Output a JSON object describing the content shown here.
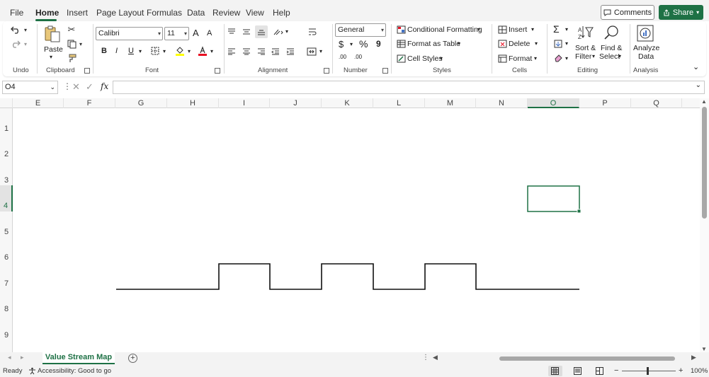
{
  "menu": {
    "tabs": [
      "File",
      "Home",
      "Insert",
      "Page Layout",
      "Formulas",
      "Data",
      "Review",
      "View",
      "Help"
    ],
    "active": "Home",
    "comments_label": "Comments",
    "share_label": "Share"
  },
  "ribbon": {
    "undo": {
      "group": "Undo"
    },
    "clipboard": {
      "group": "Clipboard",
      "paste": "Paste"
    },
    "font": {
      "group": "Font",
      "name": "Calibri",
      "size": "11",
      "bold": "B",
      "italic": "I",
      "underline": "U",
      "grow": "A",
      "shrink": "A"
    },
    "alignment": {
      "group": "Alignment"
    },
    "number": {
      "group": "Number",
      "format": "General",
      "currency": "$",
      "percent": "%",
      "comma": "9",
      "inc_dec": ".00",
      "dec_dec": ".00"
    },
    "styles": {
      "group": "Styles",
      "conditional": "Conditional Formatting",
      "format_table": "Format as Table",
      "cell_styles": "Cell Styles"
    },
    "cells": {
      "group": "Cells",
      "insert": "Insert",
      "delete": "Delete",
      "format": "Format"
    },
    "editing": {
      "group": "Editing",
      "sort": "Sort &",
      "sort2": "Filter",
      "find": "Find &",
      "find2": "Select",
      "sigma": "Σ"
    },
    "analysis": {
      "group": "Analysis",
      "analyze": "Analyze",
      "analyze2": "Data"
    }
  },
  "formula_bar": {
    "name_box": "O4",
    "fx": "fx",
    "value": ""
  },
  "grid": {
    "columns": [
      "E",
      "F",
      "G",
      "H",
      "I",
      "J",
      "K",
      "L",
      "M",
      "N",
      "O",
      "P",
      "Q"
    ],
    "rows": [
      "1",
      "2",
      "3",
      "4",
      "5",
      "6",
      "7",
      "8",
      "9"
    ],
    "selected_column": "O",
    "selected_row": "4"
  },
  "sheet_tabs": {
    "active": "Value Stream Map",
    "add": "+"
  },
  "status": {
    "ready": "Ready",
    "accessibility": "Accessibility: Good to go",
    "zoom": "100%",
    "minus": "−",
    "plus": "+"
  }
}
